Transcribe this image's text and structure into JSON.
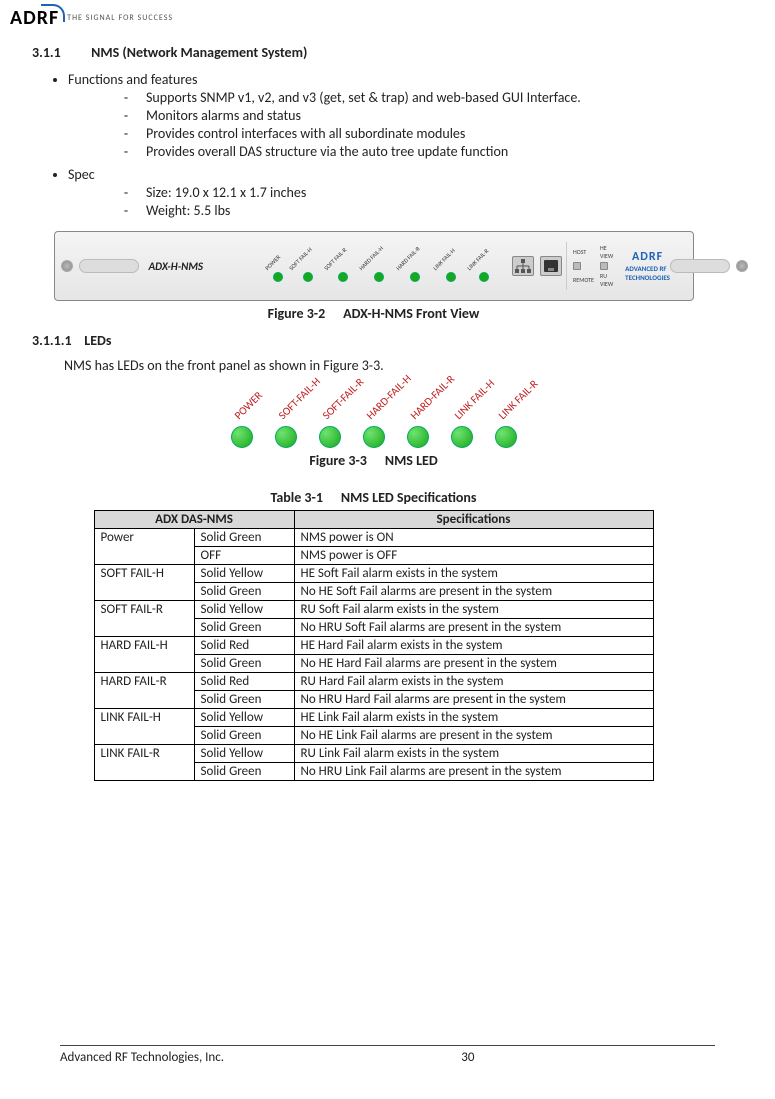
{
  "header": {
    "logo_text": "ADRF",
    "tagline": "THE SIGNAL FOR SUCCESS"
  },
  "section_311": {
    "number": "3.1.1",
    "title": "NMS (Network Management System)"
  },
  "bullets_top": {
    "functions_label": "Functions and features",
    "spec_label": "Spec"
  },
  "functions_items": [
    "Supports SNMP v1, v2, and v3 (get, set & trap) and web-based GUI Interface.",
    "Monitors alarms and status",
    "Provides control interfaces with all subordinate modules",
    "Provides overall DAS structure via the auto tree update function"
  ],
  "spec_items": [
    "Size: 19.0 x 12.1 x 1.7 inches",
    "Weight: 5.5 lbs"
  ],
  "frontpanel": {
    "model": "ADX-H-NMS",
    "led_labels": [
      "POWER",
      "SOFT FAIL-H",
      "SOFT FAIL-R",
      "HARD FAIL-H",
      "HARD FAIL-R",
      "LINK FAIL-H",
      "LINK FAIL-R"
    ],
    "switch_labels": {
      "host": "HOST",
      "heview": "HE VIEW",
      "remote": "REMOTE",
      "ruview": "RU VIEW"
    },
    "brand_big": "ADRF",
    "brand_small": "ADVANCED RF TECHNOLOGIES"
  },
  "fig32": {
    "label": "Figure 3-2",
    "title": "ADX-H-NMS Front View"
  },
  "section_3111": {
    "number": "3.1.1.1",
    "title": "LEDs"
  },
  "leds_para": "NMS has LEDs on the front panel as shown in Figure 3-3.",
  "nms_led_labels": [
    "POWER",
    "SOFT-FAIL-H",
    "SOFT-FAIL-R",
    "HARD-FAIL-H",
    "HARD-FAIL-R",
    "LINK FAIL-H",
    "LINK FAIL-R"
  ],
  "fig33": {
    "label": "Figure 3-3",
    "title": "NMS LED"
  },
  "table31": {
    "label": "Table 3-1",
    "title": "NMS LED Specifications"
  },
  "table_headers": {
    "col1": "ADX DAS-NMS",
    "col2": "Specifications"
  },
  "table_rows": [
    {
      "name": "Power",
      "state": "Solid Green",
      "spec": "NMS power is ON"
    },
    {
      "name": "",
      "state": "OFF",
      "spec": "NMS power is OFF"
    },
    {
      "name": "SOFT FAIL-H",
      "state": "Solid Yellow",
      "spec": "HE Soft Fail alarm exists in the system"
    },
    {
      "name": "",
      "state": "Solid Green",
      "spec": "No HE Soft Fail alarms are present in the system"
    },
    {
      "name": "SOFT FAIL-R",
      "state": "Solid Yellow",
      "spec": "RU Soft Fail alarm exists in the system"
    },
    {
      "name": "",
      "state": "Solid Green",
      "spec": "No HRU Soft Fail alarms are present in the system"
    },
    {
      "name": "HARD FAIL-H",
      "state": "Solid Red",
      "spec": "HE Hard Fail alarm exists in the system"
    },
    {
      "name": "",
      "state": "Solid Green",
      "spec": "No HE Hard Fail alarms are present in the system"
    },
    {
      "name": "HARD FAIL-R",
      "state": "Solid Red",
      "spec": "RU Hard Fail alarm exists in the system"
    },
    {
      "name": "",
      "state": "Solid Green",
      "spec": "No HRU Hard Fail alarms are present in the system"
    },
    {
      "name": "LINK FAIL-H",
      "state": "Solid Yellow",
      "spec": "HE Link Fail alarm exists in the system"
    },
    {
      "name": "",
      "state": "Solid Green",
      "spec": "No HE Link Fail alarms are present in the system"
    },
    {
      "name": "LINK FAIL-R",
      "state": "Solid Yellow",
      "spec": "RU Link Fail alarm exists in the system"
    },
    {
      "name": "",
      "state": "Solid Green",
      "spec": "No HRU Link Fail alarms are present in the system"
    }
  ],
  "footer": {
    "company": "Advanced RF Technologies, Inc.",
    "page": "30"
  }
}
